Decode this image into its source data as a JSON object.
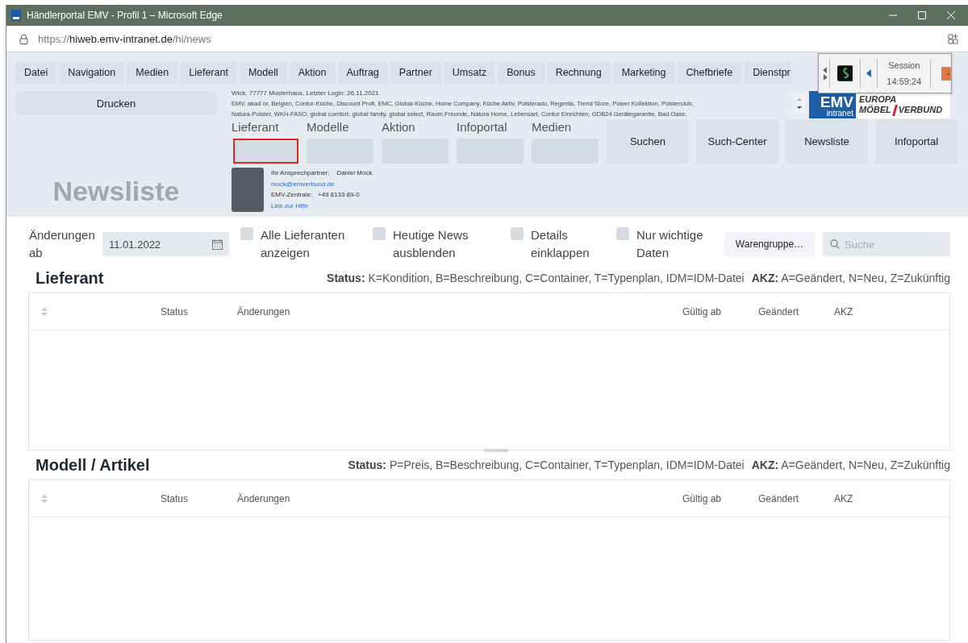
{
  "window": {
    "title": "Händlerportal EMV - Profil 1 – Microsoft Edge"
  },
  "address_bar": {
    "url_prefix": "https://",
    "url_host": "hiweb.emv-intranet.de",
    "url_path": "/hi/news"
  },
  "menu": [
    "Datei",
    "Navigation",
    "Medien",
    "Lieferant",
    "Modell",
    "Aktion",
    "Auftrag",
    "Partner",
    "Umsatz",
    "Bonus",
    "Rechnung",
    "Marketing",
    "Chefbriefe",
    "Dienstpr"
  ],
  "session": {
    "label": "Session",
    "time": "14:59:24"
  },
  "header": {
    "print_button": "Drucken",
    "page_title": "Newsliste",
    "user_line": "Wick, 77777 Musterhaus, Letzter Login: 26.11.2021",
    "brands": [
      "EMV, akad`or, Belgien, Contur-Küche, Discount Profi, EMC, Global-Küche, Home Company, Küche Aktiv, Polsterado, Regenta, Trend Store, Power Kollektion, Polsterclub,",
      "Natura-Polster, WKH-FASO, global comfort, global family, global select, Raum.Freunde, Natura Home, Lebensart, Contur Einrichten, GDB24 Gerätegarantie, Bad.Oase,"
    ],
    "logo": {
      "emv": "EMV",
      "intranet": "intranet",
      "line1": "EUROPA",
      "line2": "MÖBEL",
      "line3": "VERBUND"
    },
    "search_fields": [
      {
        "label": "Lieferant",
        "highlighted": true
      },
      {
        "label": "Modelle",
        "highlighted": false
      },
      {
        "label": "Aktion",
        "highlighted": false
      },
      {
        "label": "Infoportal",
        "highlighted": false
      },
      {
        "label": "Medien",
        "highlighted": false
      }
    ],
    "buttons": [
      "Suchen",
      "Such-Center",
      "Newsliste",
      "Infoportal"
    ],
    "contact": {
      "label": "Ihr Ansprechpartner:",
      "name": "Daniel Mock",
      "email": "mock@emverbund.de",
      "phone_label": "EMV-Zentrale:",
      "phone": "+49 8133 89-0",
      "help_link": "Link zur Hilfe"
    }
  },
  "filters": {
    "date_label": "Änderungen ab",
    "date_value": "11.01.2022",
    "checkboxes": [
      {
        "label": "Alle Lieferanten anzeigen",
        "checked": false
      },
      {
        "label": "Heutige News ausblenden",
        "checked": false
      },
      {
        "label": "Details einklappen",
        "checked": false
      },
      {
        "label": "Nur wichtige Daten",
        "checked": false
      }
    ],
    "group_button": "Warengruppe…",
    "search": {
      "placeholder": "Suche"
    }
  },
  "sections": [
    {
      "title": "Lieferant",
      "status_legend": "**Status:** K=Kondition, B=Beschreibung, C=Container, T=Typenplan, IDM=IDM-Datei",
      "akz_legend": "**AKZ:** A=Geändert, N=Neu, Z=Zukünftig",
      "columns": [
        "Status",
        "Änderungen",
        "Gültig ab",
        "Geändert",
        "AKZ"
      ]
    },
    {
      "title": "Modell / Artikel",
      "status_legend": "**Status:** P=Preis, B=Beschreibung, C=Container, T=Typenplan, IDM=IDM-Datei",
      "akz_legend": "**AKZ:** A=Geändert, N=Neu, Z=Zukünftig",
      "columns": [
        "Status",
        "Änderungen",
        "Gültig ab",
        "Geändert",
        "AKZ"
      ]
    }
  ]
}
